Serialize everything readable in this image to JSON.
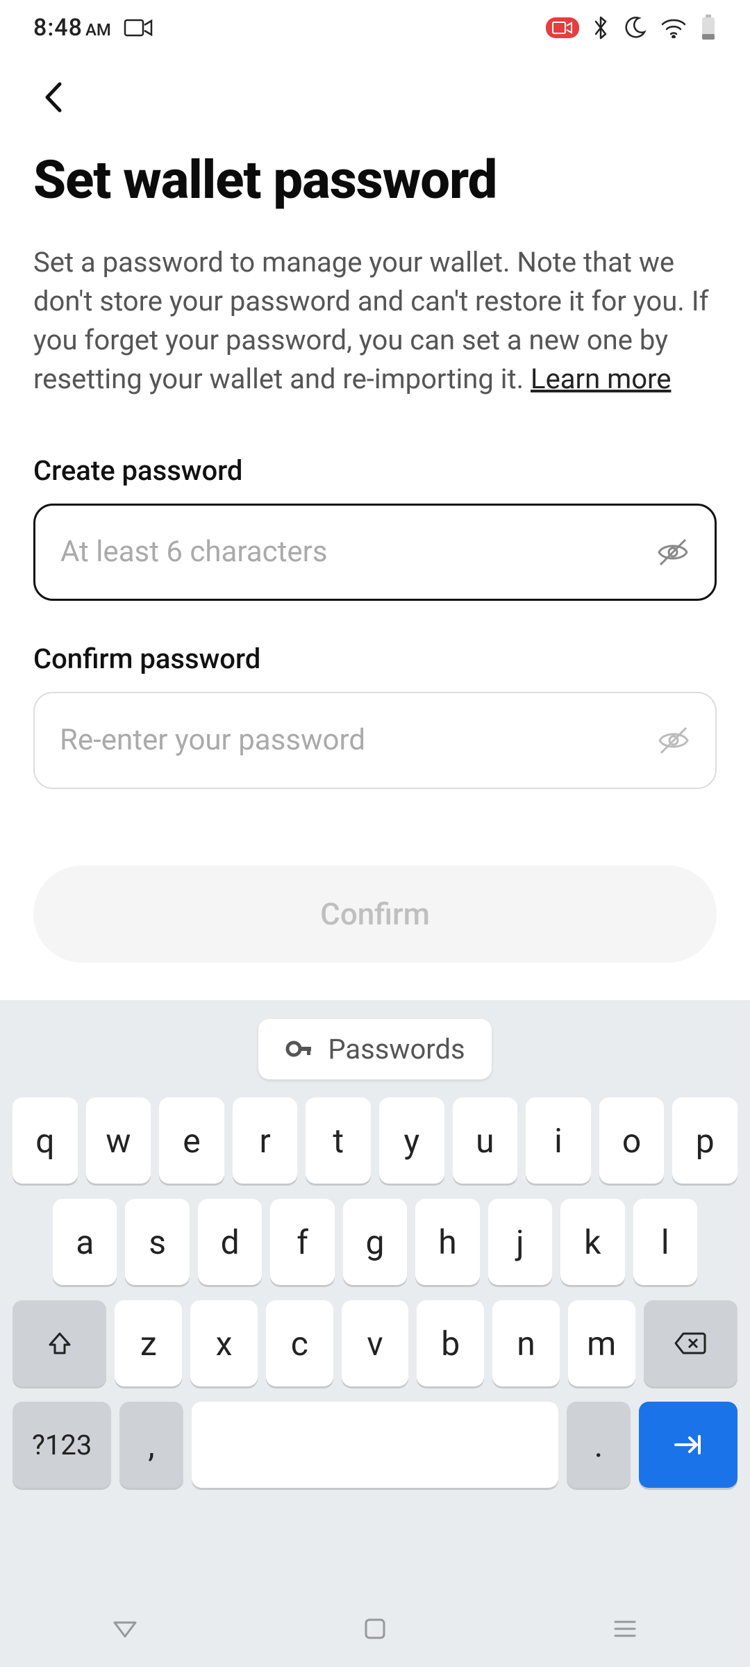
{
  "status": {
    "time": "8:48",
    "ampm": "AM"
  },
  "page": {
    "title": "Set wallet password",
    "description_part1": "Set a password to manage your wallet. Note that we don't store your password and can't restore it for you. If you forget your password, you can set a new one by resetting your wallet and re-importing it. ",
    "learn_more": "Learn more"
  },
  "fields": {
    "create": {
      "label": "Create password",
      "placeholder": "At least 6 characters",
      "value": ""
    },
    "confirm": {
      "label": "Confirm password",
      "placeholder": "Re-enter your password",
      "value": ""
    }
  },
  "actions": {
    "confirm_button": "Confirm"
  },
  "keyboard": {
    "suggestion": "Passwords",
    "row1": [
      "q",
      "w",
      "e",
      "r",
      "t",
      "y",
      "u",
      "i",
      "o",
      "p"
    ],
    "row2": [
      "a",
      "s",
      "d",
      "f",
      "g",
      "h",
      "j",
      "k",
      "l"
    ],
    "row3": [
      "z",
      "x",
      "c",
      "v",
      "b",
      "n",
      "m"
    ],
    "sym": "?123",
    "comma": ",",
    "period": "."
  }
}
